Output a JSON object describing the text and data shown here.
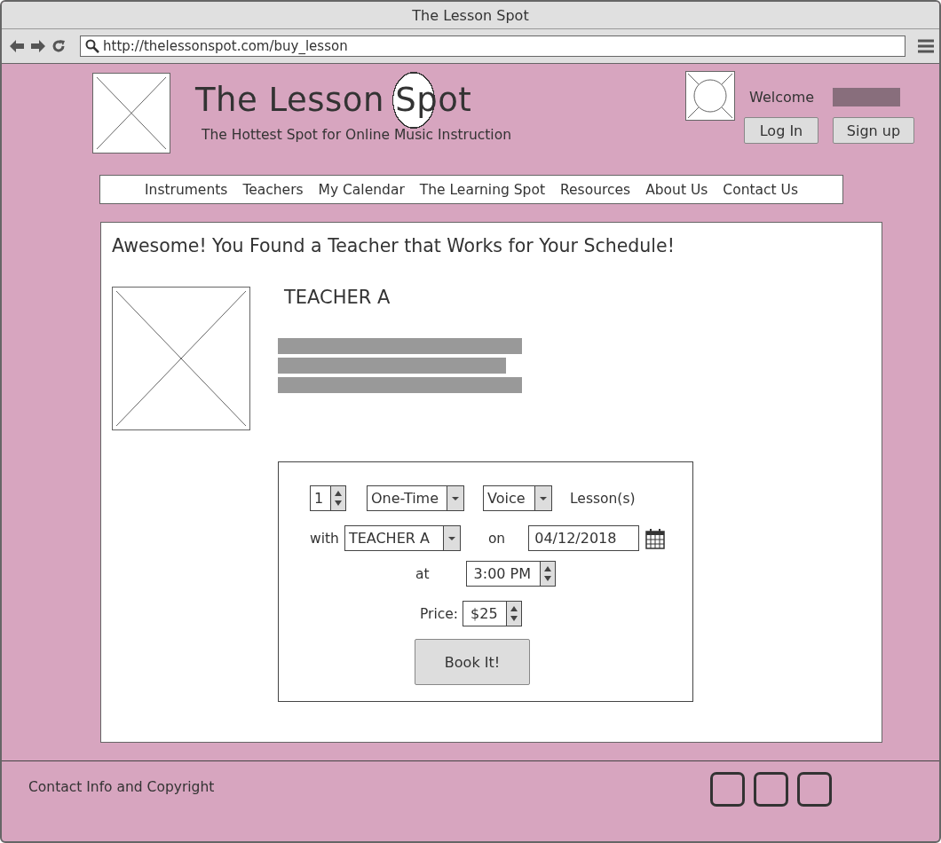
{
  "window": {
    "title": "The Lesson Spot"
  },
  "browser": {
    "url": "http://thelessonspot.com/buy_lesson"
  },
  "header": {
    "site_title": "The Lesson Spot",
    "tagline": "The Hottest Spot for Online Music Instruction",
    "welcome": "Welcome",
    "buttons": [
      "Log In",
      "Sign up"
    ]
  },
  "nav": {
    "items": [
      "Instruments",
      "Teachers",
      "My Calendar",
      "The Learning Spot",
      "Resources",
      "About Us",
      "Contact Us"
    ]
  },
  "main": {
    "heading": "Awesome! You Found a Teacher that Works for Your Schedule!",
    "teacher_name": "TEACHER A",
    "form": {
      "lesson_count": "1",
      "frequency": "One-Time",
      "instrument": "Voice",
      "lesson_label": "Lesson(s)",
      "with_label": "with",
      "teacher": "TEACHER A",
      "on_label": "on",
      "date": "04/12/2018",
      "at_label": "at",
      "time": "3:00 PM",
      "price_label": "Price:",
      "price": "$25",
      "submit": "Book It!"
    }
  },
  "footer": {
    "text": "Contact Info and Copyright"
  }
}
